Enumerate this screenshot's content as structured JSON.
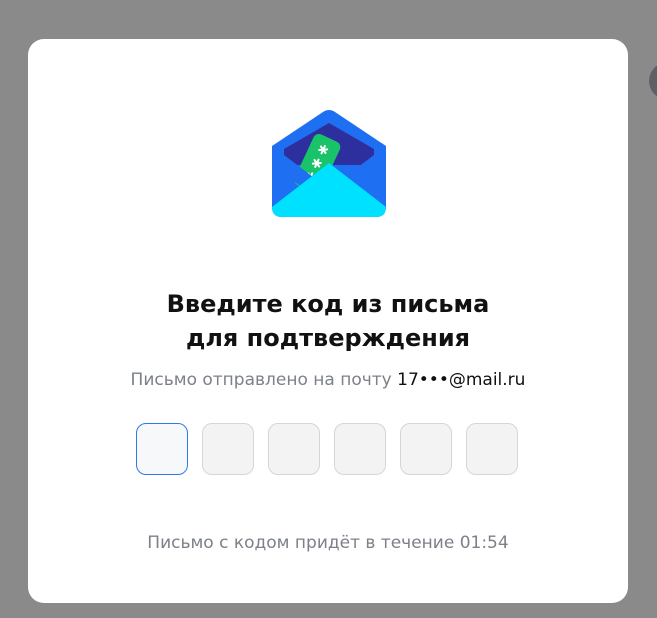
{
  "dialog": {
    "title_line1": "Введите код из письма",
    "title_line2": "для подтверждения",
    "subtitle_prefix": "Письмо отправлено на почту ",
    "email": "17•••@mail.ru",
    "code_placeholders": [
      "",
      "",
      "",
      "",
      "",
      ""
    ],
    "timer_text": "Письмо с кодом придёт в течение 01:54"
  },
  "icons": {
    "envelope": "envelope-with-password-card-icon"
  },
  "colors": {
    "envelope_blue": "#1f6ff2",
    "envelope_cyan": "#00e1ff",
    "card_green": "#18c36a",
    "accent_border": "#2e7be8"
  }
}
